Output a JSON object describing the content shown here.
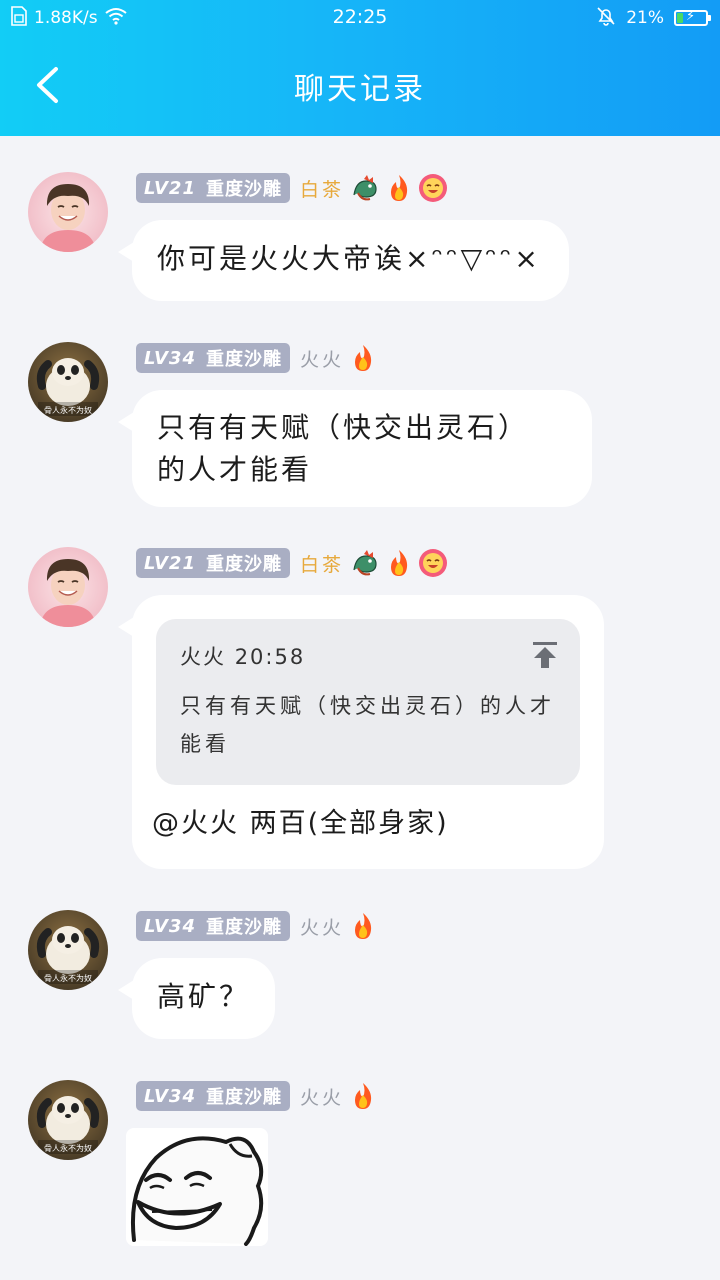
{
  "status_bar": {
    "net_speed": "1.88K/s",
    "time": "22:25",
    "battery": "21%",
    "battery_level": 0.21
  },
  "header": {
    "title": "聊天记录"
  },
  "colors": {
    "header_start": "#12cdf6",
    "header_end": "#139cf6",
    "level_badge": "#a9aec3",
    "nick_gold": "#e7a93c",
    "nick_gray": "#9a9ea8",
    "bubble": "#ffffff",
    "page_bg": "#f3f4f8"
  },
  "messages": [
    {
      "level": "LV21",
      "title": "重度沙雕",
      "nick": "白茶",
      "nick_color": "gold",
      "badges": [
        "dragon-icon",
        "fire-icon",
        "smile-flower-icon"
      ],
      "text": "你可是火火大帝诶×ᵔᵔ▽ᵔᵔ×"
    },
    {
      "level": "LV34",
      "title": "重度沙雕",
      "nick": "火火",
      "nick_color": "gray",
      "badges": [
        "fire-icon"
      ],
      "text_line1": "只有有天赋（快交出灵石）",
      "text_line2": "的人才能看",
      "avatar_caption": "骨人永不为奴"
    },
    {
      "level": "LV21",
      "title": "重度沙雕",
      "nick": "白茶",
      "nick_color": "gold",
      "badges": [
        "dragon-icon",
        "fire-icon",
        "smile-flower-icon"
      ],
      "quote": {
        "author": "火火",
        "time": "20:58",
        "line1": "只有有天赋（快交出灵石）的人才",
        "line2": "能看"
      },
      "reply": "@火火 两百(全部身家)"
    },
    {
      "level": "LV34",
      "title": "重度沙雕",
      "nick": "火火",
      "nick_color": "gray",
      "badges": [
        "fire-icon"
      ],
      "text": "高矿？",
      "avatar_caption": "骨人永不为奴"
    },
    {
      "level": "LV34",
      "title": "重度沙雕",
      "nick": "火火",
      "nick_color": "gray",
      "badges": [
        "fire-icon"
      ],
      "sticker": "grinning-face-sticker",
      "avatar_caption": "骨人永不为奴"
    }
  ]
}
